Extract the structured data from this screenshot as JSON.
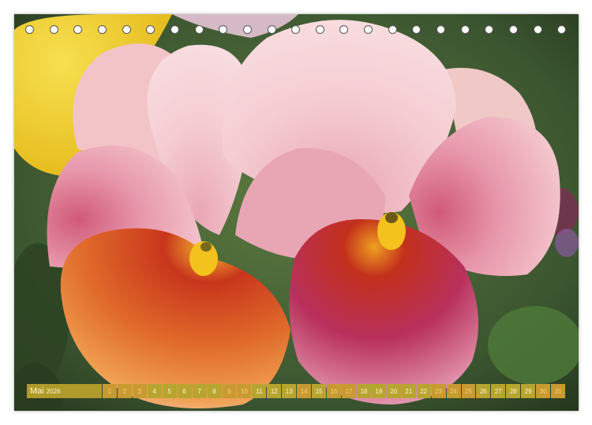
{
  "calendar": {
    "month": "Mai",
    "year": "2026",
    "days": [
      {
        "n": "1",
        "we": true
      },
      {
        "n": "2",
        "we": true
      },
      {
        "n": "3",
        "we": true
      },
      {
        "n": "4",
        "we": false
      },
      {
        "n": "5",
        "we": false
      },
      {
        "n": "6",
        "we": false
      },
      {
        "n": "7",
        "we": false
      },
      {
        "n": "8",
        "we": false
      },
      {
        "n": "9",
        "we": true
      },
      {
        "n": "10",
        "we": true
      },
      {
        "n": "11",
        "we": false
      },
      {
        "n": "12",
        "we": false
      },
      {
        "n": "13",
        "we": false
      },
      {
        "n": "14",
        "we": true
      },
      {
        "n": "15",
        "we": false
      },
      {
        "n": "16",
        "we": true
      },
      {
        "n": "17",
        "we": true
      },
      {
        "n": "18",
        "we": false
      },
      {
        "n": "19",
        "we": false
      },
      {
        "n": "20",
        "we": false
      },
      {
        "n": "21",
        "we": false
      },
      {
        "n": "22",
        "we": false
      },
      {
        "n": "23",
        "we": true
      },
      {
        "n": "24",
        "we": true
      },
      {
        "n": "25",
        "we": true
      },
      {
        "n": "26",
        "we": false
      },
      {
        "n": "27",
        "we": false
      },
      {
        "n": "28",
        "we": false
      },
      {
        "n": "29",
        "we": false
      },
      {
        "n": "30",
        "we": true
      },
      {
        "n": "31",
        "we": true
      }
    ]
  },
  "colors": {
    "background_foliage": "#3f5a2e",
    "yellow_petal": "#f2d22e",
    "petal_pink": "#f0c0c8",
    "petal_magenta": "#c43a72",
    "petal_orange": "#e0602a",
    "calendar_bar": "#b8a530"
  },
  "icons": [
    "binding-hole-icon"
  ]
}
